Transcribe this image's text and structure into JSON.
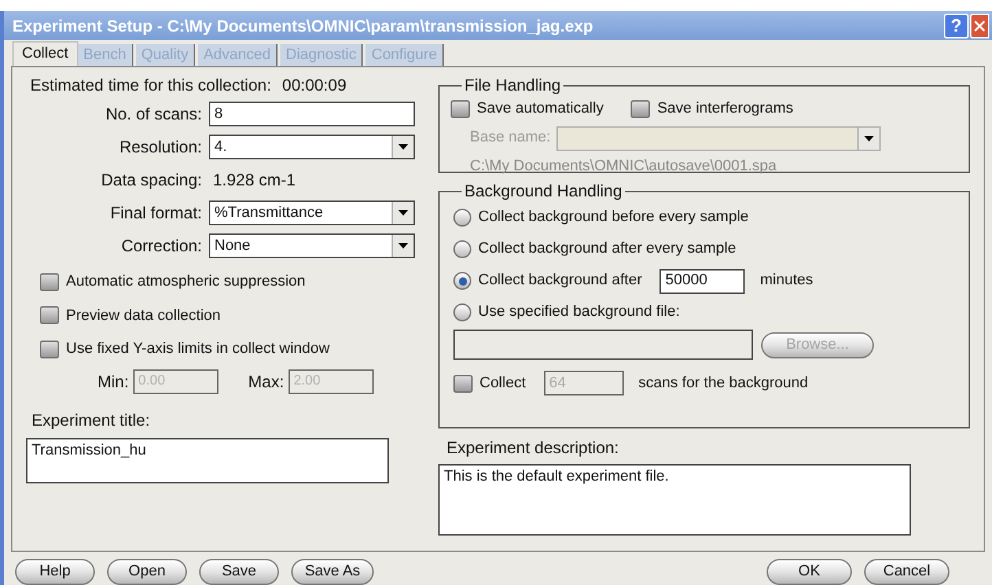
{
  "window": {
    "title": "Experiment Setup - C:\\My Documents\\OMNIC\\param\\transmission_jag.exp",
    "help": "?"
  },
  "tabs": [
    {
      "label": "Collect",
      "selected": true
    },
    {
      "label": "Bench",
      "selected": false
    },
    {
      "label": "Quality",
      "selected": false
    },
    {
      "label": "Advanced",
      "selected": false
    },
    {
      "label": "Diagnostic",
      "selected": false
    },
    {
      "label": "Configure",
      "selected": false
    }
  ],
  "estimated_time": {
    "label": "Estimated time for this collection:",
    "value": "00:00:09"
  },
  "settings": [
    {
      "kind": "text",
      "label": "No. of scans:",
      "value": "8"
    },
    {
      "kind": "select",
      "label": "Resolution:",
      "value": "4."
    },
    {
      "kind": "readout",
      "label": "Data spacing:",
      "value": "1.928 cm-1"
    },
    {
      "kind": "select",
      "label": "Final format:",
      "value": "%Transmittance"
    },
    {
      "kind": "select",
      "label": "Correction:",
      "value": "None"
    }
  ],
  "options": [
    {
      "label": "Automatic atmospheric suppression",
      "checked": false
    },
    {
      "label": "Preview data collection",
      "checked": false
    },
    {
      "label": "Use fixed Y-axis limits in collect window",
      "checked": false
    }
  ],
  "limits": [
    {
      "label": "Min:",
      "value": "0.00",
      "disabled": true
    },
    {
      "label": "Max:",
      "value": "2.00",
      "disabled": true
    }
  ],
  "experiment_title": {
    "label": "Experiment title:",
    "value": "Transmission_hu"
  },
  "file_handling": {
    "title": "File Handling",
    "options": [
      {
        "label": "Save automatically",
        "checked": false
      },
      {
        "label": "Save interferograms",
        "checked": false
      }
    ],
    "base_name": {
      "label": "Base name:",
      "disabled": true
    },
    "path": "C:\\My Documents\\OMNIC\\autosave\\0001.spa"
  },
  "background_handling": {
    "title": "Background Handling",
    "options": [
      {
        "label": "Collect background before every sample",
        "selected": false
      },
      {
        "label": "Collect background after every sample",
        "selected": false
      },
      {
        "label": "Collect background after",
        "selected": true,
        "value": "50000",
        "unit": "minutes"
      },
      {
        "label": "Use specified background file:",
        "selected": false
      }
    ],
    "browse": {
      "label": "Browse...",
      "disabled": true
    },
    "collect_scans": {
      "label": "Collect",
      "checked": false,
      "value": "64",
      "disabled": true,
      "suffix": "scans for the background"
    }
  },
  "experiment_description": {
    "label": "Experiment description:",
    "value": "This is the default experiment file."
  },
  "buttons_left": [
    "Help",
    "Open",
    "Save",
    "Save As"
  ],
  "buttons_right": [
    "OK",
    "Cancel"
  ]
}
